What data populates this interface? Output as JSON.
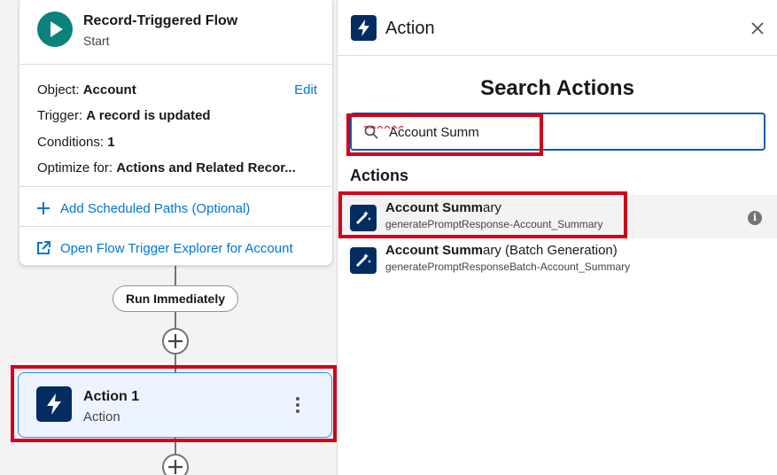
{
  "start_node": {
    "title": "Record-Triggered Flow",
    "subtitle": "Start",
    "object_label": "Object:",
    "object_value": "Account",
    "trigger_label": "Trigger:",
    "trigger_value": "A record is updated",
    "conditions_label": "Conditions:",
    "conditions_value": "1",
    "optimize_label": "Optimize for:",
    "optimize_value": "Actions and Related Recor...",
    "edit_link": "Edit",
    "add_paths_link": "Add Scheduled Paths (Optional)",
    "explorer_link": "Open Flow Trigger Explorer for Account"
  },
  "connector": {
    "run_label": "Run Immediately"
  },
  "action_node": {
    "title": "Action 1",
    "subtitle": "Action"
  },
  "panel": {
    "title": "Action",
    "search_heading": "Search Actions",
    "search_value": "Account Summ",
    "section_label": "Actions",
    "results": [
      {
        "match": "Account Summ",
        "rest": "ary",
        "api_name": "generatePromptResponse-Account_Summary"
      },
      {
        "match": "Account Summ",
        "rest": "ary (Batch Generation)",
        "api_name": "generatePromptResponseBatch-Account_Summary"
      }
    ]
  },
  "colors": {
    "flow_teal": "#0b827c",
    "action_navy": "#032d60",
    "link_blue": "#0176d3",
    "highlight_red": "#d0021b",
    "selected_border": "#1b96ff"
  }
}
